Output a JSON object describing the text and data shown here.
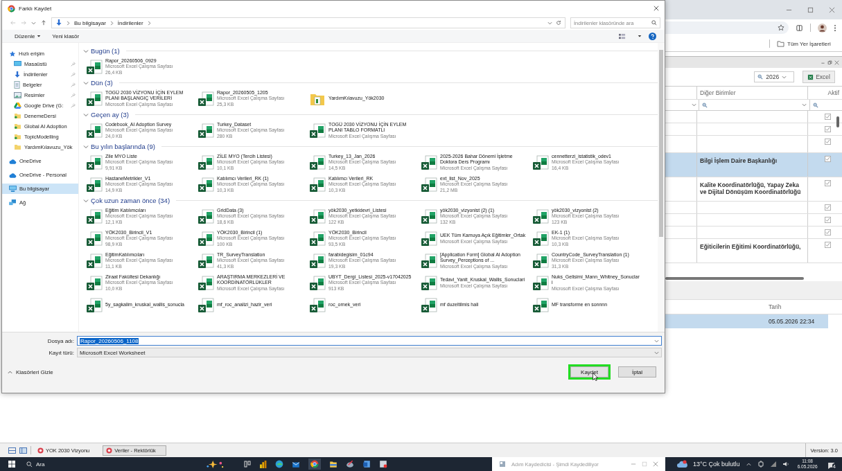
{
  "dialog": {
    "title": "Farklı Kaydet",
    "breadcrumb": [
      "Bu bilgisayar",
      "İndirilenler"
    ],
    "search": {
      "placeholder": "İndirilenler klasöründe ara"
    },
    "commands": [
      {
        "label": "Düzenle",
        "dropdown": true
      },
      {
        "label": "Yeni klasör",
        "dropdown": false
      }
    ],
    "sidebar": [
      {
        "label": "Hızlı erişim",
        "kind": "quick",
        "pinned": false,
        "selected": false
      },
      {
        "label": "Masaüstü",
        "kind": "desktop",
        "pinned": true,
        "selected": false
      },
      {
        "label": "İndirilenler",
        "kind": "downloads",
        "pinned": true,
        "selected": false
      },
      {
        "label": "Belgeler",
        "kind": "documents",
        "pinned": true,
        "selected": false
      },
      {
        "label": "Resimler",
        "kind": "pictures",
        "pinned": true,
        "selected": false
      },
      {
        "label": "Google Drive (G:",
        "kind": "drive",
        "pinned": true,
        "selected": false
      },
      {
        "label": "DenemeDersi",
        "kind": "synced",
        "pinned": false,
        "selected": false
      },
      {
        "label": "Global AI Adoption",
        "kind": "synced",
        "pinned": false,
        "selected": false
      },
      {
        "label": "TopicModelling",
        "kind": "synced",
        "pinned": false,
        "selected": false
      },
      {
        "label": "YardımKılavuzu_Yök",
        "kind": "folder",
        "pinned": false,
        "selected": false
      },
      {
        "label": "OneDrive",
        "kind": "cloud",
        "pinned": false,
        "selected": false
      },
      {
        "label": "OneDrive - Personal",
        "kind": "cloud",
        "pinned": false,
        "selected": false
      },
      {
        "label": "Bu bilgisayar",
        "kind": "computer",
        "pinned": false,
        "selected": true
      },
      {
        "label": "Ağ",
        "kind": "network",
        "pinned": false,
        "selected": false
      }
    ],
    "groups": [
      {
        "title": "Bugün (1)",
        "expanded": true,
        "files": [
          {
            "kind": "excel",
            "name": "Rapor_20260506_0929",
            "type": "Microsoft Excel Çalışma Sayfası",
            "size": "26,4 KB"
          }
        ]
      },
      {
        "title": "Dün (3)",
        "expanded": true,
        "files": [
          {
            "kind": "excel",
            "name": "TOGÜ 2030 VİZYONU İÇİN EYLEM PLANI BAŞLANGIÇ VERİLERİ",
            "type": "Microsoft Excel Çalışma Sayfası"
          },
          {
            "kind": "excel",
            "name": "Rapor_20260505_1205",
            "type": "Microsoft Excel Çalışma Sayfası",
            "size": "25,3 KB"
          },
          {
            "kind": "folder",
            "name": "YardımKılavuzu_Yök2030"
          }
        ]
      },
      {
        "title": "Geçen ay (3)",
        "expanded": true,
        "files": [
          {
            "kind": "excel",
            "name": "Codebook_AI Adoption Survey",
            "type": "Microsoft Excel Çalışma Sayfası",
            "size": "24,0 KB"
          },
          {
            "kind": "excel",
            "name": "Turkey_Dataset",
            "type": "Microsoft Excel Çalışma Sayfası",
            "size": "280 KB"
          },
          {
            "kind": "excel",
            "name": "TOGÜ 2030 VİZYONU İÇİN EYLEM PLANI TABLO FORMATLI",
            "type": "Microsoft Excel Çalışma Sayfası"
          }
        ]
      },
      {
        "title": "Bu yılın başlarında (9)",
        "expanded": true,
        "files": [
          {
            "kind": "excel",
            "name": "Zile MYO Liste",
            "type": "Microsoft Excel Çalışma Sayfası",
            "size": "9,91 KB"
          },
          {
            "kind": "excel",
            "name": "ZİLE MYO (Tercih Listesi)",
            "type": "Microsoft Excel Çalışma Sayfası",
            "size": "10,1 KB"
          },
          {
            "kind": "excel",
            "name": "Turkey_13_Jan_2026",
            "type": "Microsoft Excel Çalışma Sayfası",
            "size": "14,5 KB"
          },
          {
            "kind": "excel",
            "name": "2025-2026 Bahar Dönemi İşletme Doktora Ders Programı",
            "type": "Microsoft Excel Çalışma Sayfası"
          },
          {
            "kind": "excel",
            "name": "cennetterzi_istatistik_odev1",
            "type": "Microsoft Excel Çalışma Sayfası",
            "size": "16,4 KB"
          },
          {
            "kind": "excel",
            "name": "HastaneMetrikler_V1",
            "type": "Microsoft Excel Çalışma Sayfası",
            "size": "14,9 KB"
          },
          {
            "kind": "excel",
            "name": "Katılımcı Verileri_RK (1)",
            "type": "Microsoft Excel Çalışma Sayfası",
            "size": "10,3 KB"
          },
          {
            "kind": "excel",
            "name": "Katılımcı Verileri_RK",
            "type": "Microsoft Excel Çalışma Sayfası",
            "size": "10,3 KB"
          },
          {
            "kind": "excel",
            "name": "ext_list_Nov_2025",
            "type": "Microsoft Excel Çalışma Sayfası",
            "size": "21,2 MB"
          }
        ]
      },
      {
        "title": "Çok uzun zaman önce (34)",
        "expanded": true,
        "files": [
          {
            "kind": "excel",
            "name": "Eğitim Katılımcıları",
            "type": "Microsoft Excel Çalışma Sayfası",
            "size": "12,1 KB"
          },
          {
            "kind": "excel",
            "name": "GridData (3)",
            "type": "Microsoft Excel Çalışma Sayfası",
            "size": "18,6 KB"
          },
          {
            "kind": "excel",
            "name": "yök2030_yetkidevri_Listesi",
            "type": "Microsoft Excel Çalışma Sayfası",
            "size": "122 KB"
          },
          {
            "kind": "excel",
            "name": "yök2030_vizyonlst (2) (1)",
            "type": "Microsoft Excel Çalışma Sayfası",
            "size": "132 KB"
          },
          {
            "kind": "excel",
            "name": "yök2030_vizyonlst (2)",
            "type": "Microsoft Excel Çalışma Sayfası",
            "size": "123 KB"
          },
          {
            "kind": "excel",
            "name": "YÖK2030_Birincil_V1",
            "type": "Microsoft Excel Çalışma Sayfası",
            "size": "98,9 KB"
          },
          {
            "kind": "excel",
            "name": "YÖK2030_Birincil (1)",
            "type": "Microsoft Excel Çalışma Sayfası",
            "size": "100 KB"
          },
          {
            "kind": "excel",
            "name": "YÖK2030_Birincil",
            "type": "Microsoft Excel Çalışma Sayfası",
            "size": "93,5 KB"
          },
          {
            "kind": "excel",
            "name": "UEK Tüm Kamuya Açık Eğitimler_Ortak",
            "type": "Microsoft Excel Çalışma Sayfası"
          },
          {
            "kind": "excel",
            "name": "EK-1 (1)",
            "type": "Microsoft Excel Çalışma Sayfası",
            "size": "10,3 KB"
          },
          {
            "kind": "excel",
            "name": "EğitimKatılımcıları",
            "type": "Microsoft Excel Çalışma Sayfası",
            "size": "11,1 KB"
          },
          {
            "kind": "excel",
            "name": "TR_SurveyTranslation",
            "type": "Microsoft Excel Çalışma Sayfası",
            "size": "41,3 KB"
          },
          {
            "kind": "excel",
            "name": "farabidegisim_01c94",
            "type": "Microsoft Excel Çalışma Sayfası",
            "size": "19,3 KB"
          },
          {
            "kind": "excel",
            "name": "[Application Form] Global AI Adoption Survey_Perceptions of ...",
            "type": "Microsoft Excel Çalışma Sayfası"
          },
          {
            "kind": "excel",
            "name": "CountryCode_SurveyTranslation (1)",
            "type": "Microsoft Excel Çalışma Sayfası",
            "size": "31,3 KB"
          },
          {
            "kind": "excel",
            "name": "Ziraat Fakültesi Dekanlığı",
            "type": "Microsoft Excel Çalışma Sayfası",
            "size": "10,0 KB"
          },
          {
            "kind": "excel",
            "name": "ARAŞTIRMA MERKEZLERİ VE KOORDİNATÖRLÜKLER",
            "type": "Microsoft Excel Çalışma Sayfası"
          },
          {
            "kind": "excel",
            "name": "UBYT_Dergi_Listesi_2025-v17042025",
            "type": "Microsoft Excel Çalışma Sayfası",
            "size": "913 KB"
          },
          {
            "kind": "excel",
            "name": "Tedavi_Yanit_Kruskal_Wallis_Sonuclari",
            "type": "Microsoft Excel Çalışma Sayfası"
          },
          {
            "kind": "excel",
            "name": "Nuks_Gelisimi_Mann_Whitney_Sonuclari",
            "type": "Microsoft Excel Çalışma Sayfası"
          },
          {
            "kind": "excel",
            "name": "5y_sagkalim_kruskal_wallis_sonucla"
          },
          {
            "kind": "excel",
            "name": "mf_roc_analizi_hazir_veri"
          },
          {
            "kind": "excel",
            "name": "roc_ornek_veri"
          },
          {
            "kind": "excel",
            "name": "mf duzeltilmis hali"
          },
          {
            "kind": "excel",
            "name": "MF transforme en sonnnn"
          }
        ]
      }
    ],
    "filename": {
      "label": "Dosya adı:",
      "value": "Rapor_20260506_1108",
      "text_selected": true
    },
    "filetype": {
      "label": "Kayıt türü:",
      "value": "Microsoft Excel Worksheet"
    },
    "toggle": {
      "label": "Klasörleri Gizle"
    },
    "buttons": [
      {
        "label": "Kaydet",
        "highlighted": true
      },
      {
        "label": "İptal",
        "highlighted": false
      }
    ]
  },
  "browser": {
    "bookmarks": {
      "label": "Tüm Yer İşaretleri"
    },
    "app": {
      "year": {
        "value": "2026"
      },
      "export_button": "Excel",
      "grid": {
        "columns": [
          "Diğer Birimler",
          "Aktif"
        ],
        "rows": [
          {
            "checked": true,
            "selected": false
          },
          {
            "checked": true,
            "selected": false
          },
          {
            "checked": true,
            "selected": false
          },
          {
            "text": "Bilgi İşlem Daire Başkanlığı",
            "checked": true,
            "selected": true
          },
          {
            "text": "Kalite Koordinatörlüğü, Yapay Zeka ve Dijital Dönüşüm Koordinatörlüğü",
            "checked": true,
            "selected": false
          },
          {
            "checked": true,
            "selected": false
          },
          {
            "checked": true,
            "selected": false
          },
          {
            "checked": true,
            "selected": false
          },
          {
            "text": "Eğiticilerin Eğitimi Koordinatörlüğü,",
            "checked": true,
            "selected": false
          }
        ]
      },
      "detail": {
        "columns": [
          "Tarih"
        ],
        "rows": [
          {
            "date": "05.05.2026 22:34",
            "selected": true
          }
        ]
      }
    },
    "tabs": [
      {
        "label": "YOK 2030 Vizyonu",
        "selected": false
      },
      {
        "label": "Veriler - Rektörlük",
        "selected": true
      }
    ],
    "version": "Version: 3.0"
  },
  "taskbar": {
    "search": {
      "placeholder": "Ara"
    },
    "recorder": {
      "title": "Adım Kaydedicisi - Şimdi Kaydediliyor"
    },
    "weather": "13°C Çok bulutlu",
    "time": "11:08",
    "date": "6.05.2026",
    "notifications": "4"
  }
}
